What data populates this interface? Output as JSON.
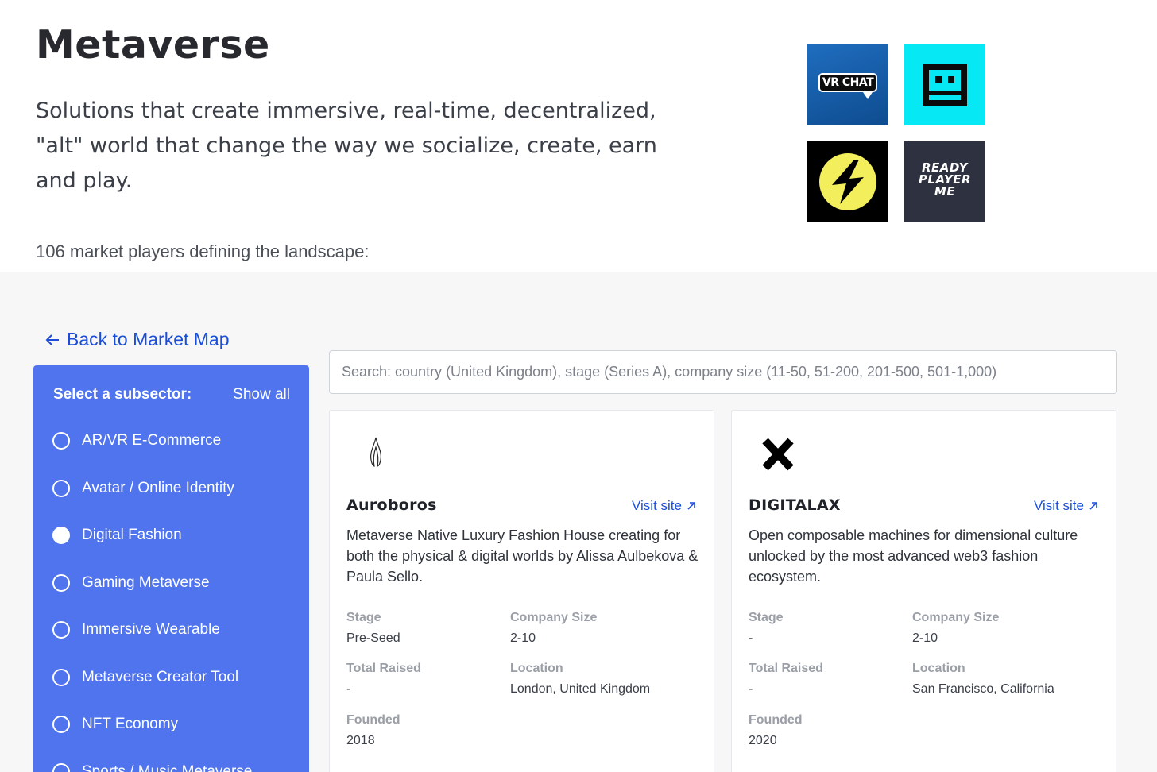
{
  "hero": {
    "title": "Metaverse",
    "description": "Solutions that create immersive, real-time, decentralized, \"alt\" world that change the way we socialize, create, earn and play.",
    "count_text": "106 market players defining the landscape:",
    "logos": [
      {
        "icon": "vrchat-logo",
        "text": "VR CHAT",
        "color": "#1565b4"
      },
      {
        "icon": "robot-face-logo",
        "color": "#06e8f4"
      },
      {
        "icon": "lightning-bolt-logo",
        "color": "#f3ee5c"
      },
      {
        "icon": "ready-player-me-logo",
        "text_lines": [
          "READY",
          "PLAYER",
          "ME"
        ],
        "color": "#2e3140"
      }
    ]
  },
  "nav": {
    "back_label": "Back to Market Map"
  },
  "sidebar": {
    "title": "Select a subsector:",
    "show_all": "Show all",
    "items": [
      {
        "label": "AR/VR E-Commerce",
        "selected": false
      },
      {
        "label": "Avatar / Online Identity",
        "selected": false
      },
      {
        "label": "Digital Fashion",
        "selected": true
      },
      {
        "label": "Gaming Metaverse",
        "selected": false
      },
      {
        "label": "Immersive Wearable",
        "selected": false
      },
      {
        "label": "Metaverse Creator Tool",
        "selected": false
      },
      {
        "label": "NFT Economy",
        "selected": false
      },
      {
        "label": "Sports / Music Metaverse",
        "selected": false
      }
    ]
  },
  "search": {
    "placeholder": "Search: country (United Kingdom), stage (Series A), company size (11-50, 51-200, 201-500, 501-1,000)",
    "value": ""
  },
  "field_labels": {
    "stage": "Stage",
    "company_size": "Company Size",
    "total_raised": "Total Raised",
    "location": "Location",
    "founded": "Founded"
  },
  "cards": [
    {
      "name": "Auroboros",
      "visit_label": "Visit site",
      "description": "Metaverse Native Luxury Fashion House creating for both the physical & digital worlds by Alissa Aulbekova & Paula Sello.",
      "stage": "Pre-Seed",
      "company_size": "2-10",
      "total_raised": "-",
      "location": "London, United Kingdom",
      "founded": "2018",
      "logo_icon": "auroboros-logo"
    },
    {
      "name": "DIGITALAX",
      "visit_label": "Visit site",
      "description": "Open composable machines for dimensional culture unlocked by the most advanced web3 fashion ecosystem.",
      "stage": "-",
      "company_size": "2-10",
      "total_raised": "-",
      "location": "San Francisco, California",
      "founded": "2020",
      "logo_icon": "digitalax-x-logo"
    }
  ],
  "colors": {
    "accent_blue": "#1a4ed8",
    "sidebar_bg": "#4f74ee",
    "panel_bg": "#f7f7f8"
  }
}
